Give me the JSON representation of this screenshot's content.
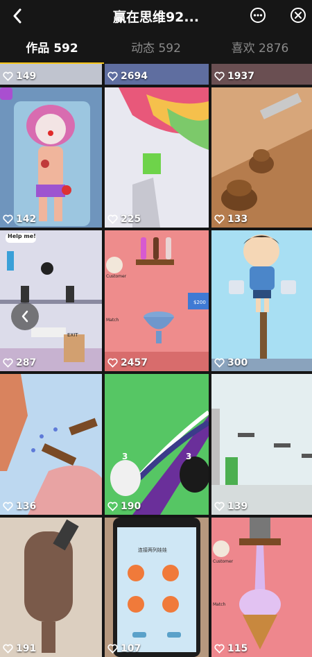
{
  "header": {
    "title": "赢在思维92...",
    "colors": {
      "accent": "#f5c518",
      "background": "#161616"
    }
  },
  "tabs": [
    {
      "label": "作品 592",
      "active": true
    },
    {
      "label": "动态 592",
      "active": false
    },
    {
      "label": "喜欢 2876",
      "active": false
    }
  ],
  "videos": [
    {
      "likes": "149"
    },
    {
      "likes": "2694"
    },
    {
      "likes": "1937"
    },
    {
      "likes": "142"
    },
    {
      "likes": "225"
    },
    {
      "likes": "133"
    },
    {
      "likes": "287",
      "text": "Help me!",
      "exit_label": "EXIT"
    },
    {
      "likes": "2457",
      "customer_label": "Customer",
      "match_label": "Match",
      "price_label": "$200"
    },
    {
      "likes": "300"
    },
    {
      "likes": "136"
    },
    {
      "likes": "190",
      "counter_a": "3",
      "counter_b": "3"
    },
    {
      "likes": "139"
    },
    {
      "likes": "191"
    },
    {
      "likes": "107",
      "screen_text": "连接两列娃娃"
    },
    {
      "likes": "115",
      "customer_label": "Customer",
      "match_label": "Match"
    }
  ]
}
